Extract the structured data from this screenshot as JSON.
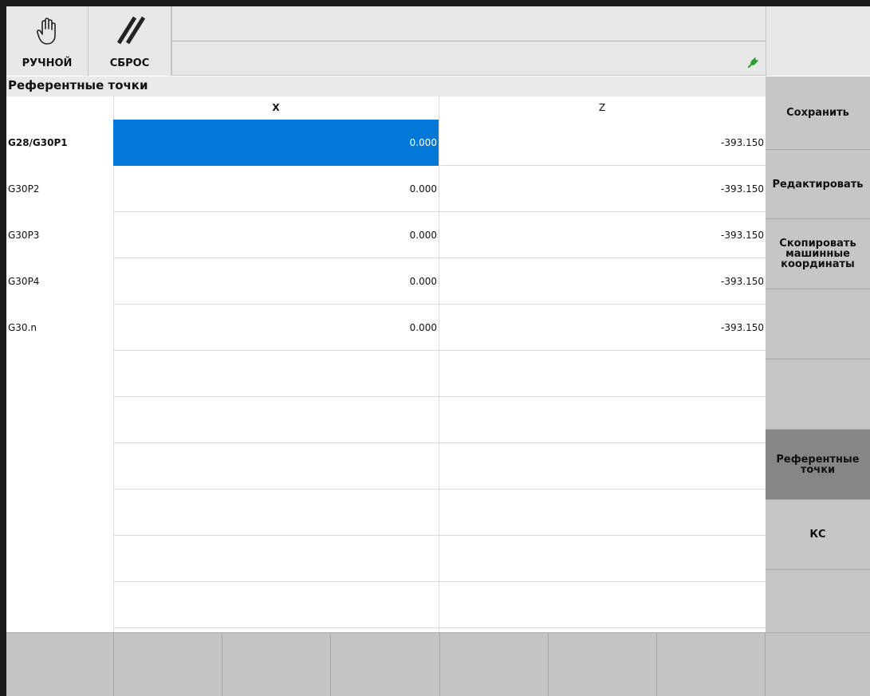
{
  "top": {
    "mode_label": "РУЧНОЙ",
    "reset_label": "СБРОС"
  },
  "page_title": "Референтные точки",
  "table": {
    "columns": [
      "X",
      "Z"
    ],
    "rows": [
      {
        "label": "G28/G30P1",
        "x": "0.000",
        "z": "-393.150"
      },
      {
        "label": "G30P2",
        "x": "0.000",
        "z": "-393.150"
      },
      {
        "label": "G30P3",
        "x": "0.000",
        "z": "-393.150"
      },
      {
        "label": "G30P4",
        "x": "0.000",
        "z": "-393.150"
      },
      {
        "label": "G30.n",
        "x": "0.000",
        "z": "-393.150"
      }
    ]
  },
  "softkeys": {
    "save": "Сохранить",
    "edit": "Редактировать",
    "copy": "Скопировать машинные координаты",
    "ref_points": "Референтные точки",
    "cs": "КС"
  },
  "icons": {
    "mode": "hand-icon",
    "reset": "reset-slashes-icon",
    "status": "connection-plug-icon"
  },
  "colors": {
    "selection": "#0078d7",
    "active_softkey": "#868686",
    "status_green": "#2e9e2e"
  }
}
